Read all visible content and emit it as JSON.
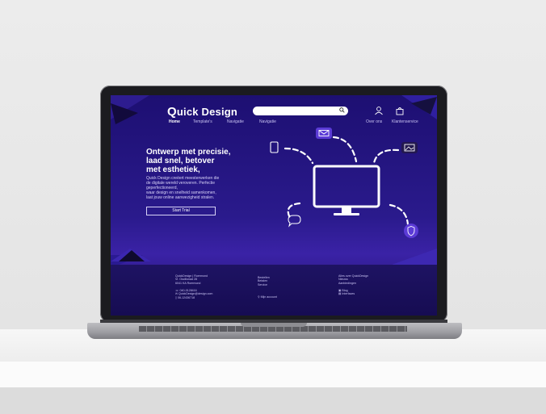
{
  "site": {
    "logo_initial": "Q",
    "logo_rest": "uick Design",
    "nav": [
      "Home",
      "Template's",
      "Navigatie",
      "Navigatie"
    ],
    "nav_right": [
      "Over ons",
      "Klantenservice"
    ],
    "icons": [
      "search-icon",
      "user-icon",
      "bag-icon"
    ]
  },
  "hero": {
    "headline_1": "Ontwerp met precisie,",
    "headline_2": "laad snel, betover",
    "headline_3": "met esthetiek,",
    "desc_1": "Quick Design creëert meesterwerken die",
    "desc_2": "de digitale wereld veroveren. Perfectie",
    "desc_3": "geperfectioneerd,",
    "desc_4": "waar design en snelheid samenkomen,",
    "desc_5": "laat jouw online aanwezigheid stralen.",
    "cta": "Start Trial"
  },
  "illustration": {
    "icons": [
      "monitor-icon",
      "phone-icon",
      "mail-icon",
      "image-icon",
      "chat-icon",
      "shield-icon"
    ]
  },
  "footer": {
    "col1": [
      "QuickDesign | Roermond",
      "Vl. Oscillonad 28",
      "6041 KA Roermond"
    ],
    "contact": [
      "040-0128416",
      "QuickDesign@design.com",
      "06-12436718"
    ],
    "col2": [
      "Bestellen",
      "Betalen",
      "Service"
    ],
    "account": "Mijn account",
    "col3": [
      "Alles over QuickDesign",
      "Nieuws",
      "Aanbiedingen"
    ],
    "col3b": [
      "Blog",
      "Interfaces"
    ]
  },
  "colors": {
    "bg_top": "#1d0f72",
    "bg_mid": "#3a22a6",
    "accent": "#5b3bd6",
    "text": "#ffffff"
  }
}
